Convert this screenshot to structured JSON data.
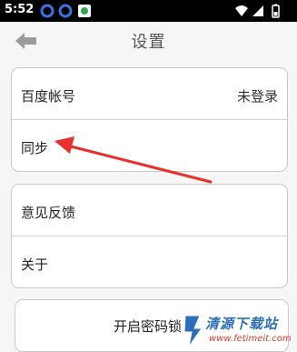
{
  "status_bar": {
    "time": "5:52"
  },
  "header": {
    "title": "设置",
    "back_icon": "arrow-left-icon"
  },
  "account_group": {
    "items": [
      {
        "label": "百度帐号",
        "value": "未登录"
      },
      {
        "label": "同步"
      }
    ]
  },
  "info_group": {
    "items": [
      {
        "label": "意见反馈"
      },
      {
        "label": "关于"
      }
    ]
  },
  "password_lock": {
    "label": "开启密码锁"
  },
  "watermark": {
    "brand": "清源下载站",
    "url": "www.fetimeit.com"
  },
  "colors": {
    "background": "#f6f6f6",
    "annotation_arrow": "#e8302a",
    "watermark_blue": "#2a6fb8"
  }
}
